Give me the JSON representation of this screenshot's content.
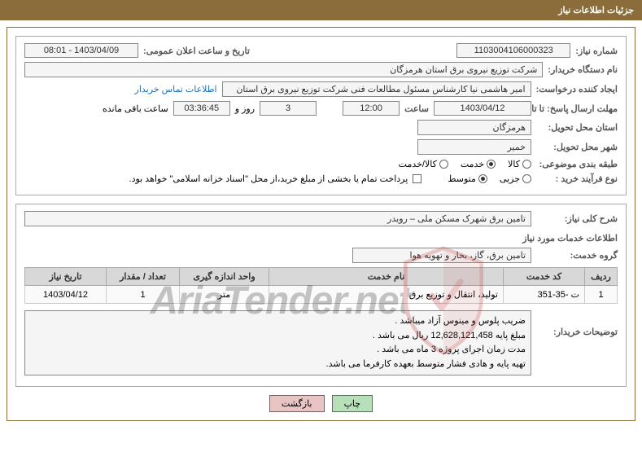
{
  "header": {
    "title": "جزئیات اطلاعات نیاز"
  },
  "form": {
    "need_number_label": "شماره نیاز:",
    "need_number": "1103004106000323",
    "announce_date_label": "تاریخ و ساعت اعلان عمومی:",
    "announce_date": "1403/04/09 - 08:01",
    "buyer_org_label": "نام دستگاه خریدار:",
    "buyer_org": "شرکت توزیع نیروی برق استان هرمزگان",
    "requester_label": "ایجاد کننده درخواست:",
    "requester": "امیر هاشمی نیا کارشناس مسئول مطالعات فنی شرکت توزیع نیروی برق استان",
    "buyer_contact_link": "اطلاعات تماس خریدار",
    "deadline_label": "مهلت ارسال پاسخ: تا تاریخ:",
    "deadline_date": "1403/04/12",
    "time_label": "ساعت",
    "deadline_time": "12:00",
    "days_count": "3",
    "days_word": "روز و",
    "remaining_time": "03:36:45",
    "remaining_label": "ساعت باقی مانده",
    "province_label": "استان محل تحویل:",
    "province": "هرمزگان",
    "city_label": "شهر محل تحویل:",
    "city": "خمیر",
    "category_label": "طبقه بندی موضوعی:",
    "cat_goods": "کالا",
    "cat_service": "خدمت",
    "cat_goods_service": "کالا/خدمت",
    "purchase_type_label": "نوع فرآیند خرید :",
    "type_minor": "جزیی",
    "type_medium": "متوسط",
    "payment_note": "پرداخت تمام یا بخشی از مبلغ خرید،از محل \"اسناد خزانه اسلامی\" خواهد بود."
  },
  "need": {
    "summary_label": "شرح کلی نیاز:",
    "summary": "تامین برق شهرک مسکن ملی – رویدر",
    "services_info_label": "اطلاعات خدمات مورد نیاز",
    "service_group_label": "گروه خدمت:",
    "service_group": "تامین برق، گاز، بخار و تهویه هوا"
  },
  "table": {
    "headers": {
      "row": "ردیف",
      "code": "کد خدمت",
      "name": "نام خدمت",
      "unit": "واحد اندازه گیری",
      "qty": "تعداد / مقدار",
      "date": "تاریخ نیاز"
    },
    "rows": [
      {
        "row": "1",
        "code": "ت -35-351",
        "name": "تولید، انتقال و توزیع برق",
        "unit": "متر",
        "qty": "1",
        "date": "1403/04/12"
      }
    ]
  },
  "desc": {
    "label": "توضیحات خریدار:",
    "line1": "ضریب پلوس و مینوس آزاد میباشد .",
    "line2": "مبلغ پایه 12,628,121,458 ریال می باشد .",
    "line3": "مدت زمان اجرای پروژه 3 ماه می باشد .",
    "line4": "تهیه پایه و هادی فشار متوسط بعهده کارفرما می باشد."
  },
  "buttons": {
    "print": "چاپ",
    "back": "بازگشت"
  },
  "watermark": {
    "text": "AriaTender.net"
  }
}
